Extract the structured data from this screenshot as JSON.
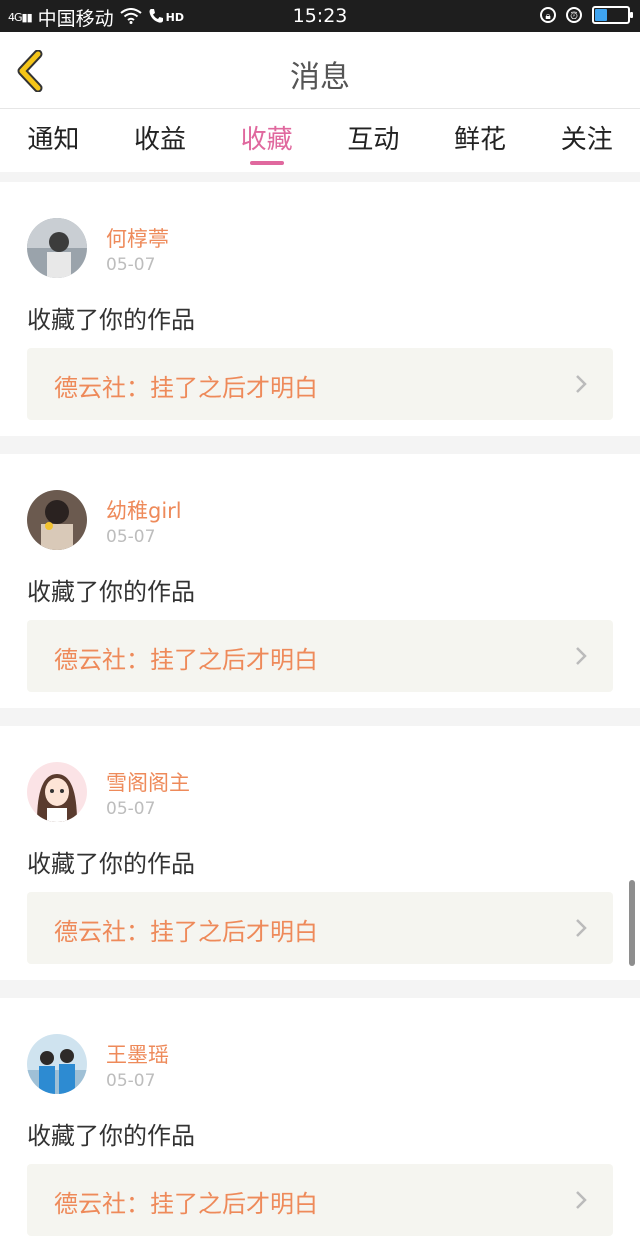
{
  "status_bar": {
    "signal": "4G",
    "carrier": "中国移动",
    "volte": "HD",
    "time": "15:23",
    "battery_level": 0.4,
    "icons": [
      "signal-icon",
      "wifi-icon",
      "call-icon",
      "lock-icon",
      "alarm-icon",
      "battery-icon"
    ]
  },
  "header": {
    "title": "消息",
    "back_icon": "chevron-left-icon",
    "accent_color": "#f5c518"
  },
  "tabs": [
    {
      "label": "通知",
      "active": false
    },
    {
      "label": "收益",
      "active": false
    },
    {
      "label": "收藏",
      "active": true
    },
    {
      "label": "互动",
      "active": false
    },
    {
      "label": "鲜花",
      "active": false
    },
    {
      "label": "关注",
      "active": false
    }
  ],
  "colors": {
    "active_tab": "#e0689e",
    "name": "#ee8a5a",
    "date": "#bdbdbd"
  },
  "messages": [
    {
      "name": "何椁葶",
      "date": "05-07",
      "action": "收藏了你的作品",
      "work": "德云社：挂了之后才明白"
    },
    {
      "name": "幼稚girl",
      "date": "05-07",
      "action": "收藏了你的作品",
      "work": "德云社：挂了之后才明白"
    },
    {
      "name": "雪阁阁主",
      "date": "05-07",
      "action": "收藏了你的作品",
      "work": "德云社：挂了之后才明白"
    },
    {
      "name": "王墨瑶",
      "date": "05-07",
      "action": "收藏了你的作品",
      "work": "德云社：挂了之后才明白"
    }
  ]
}
